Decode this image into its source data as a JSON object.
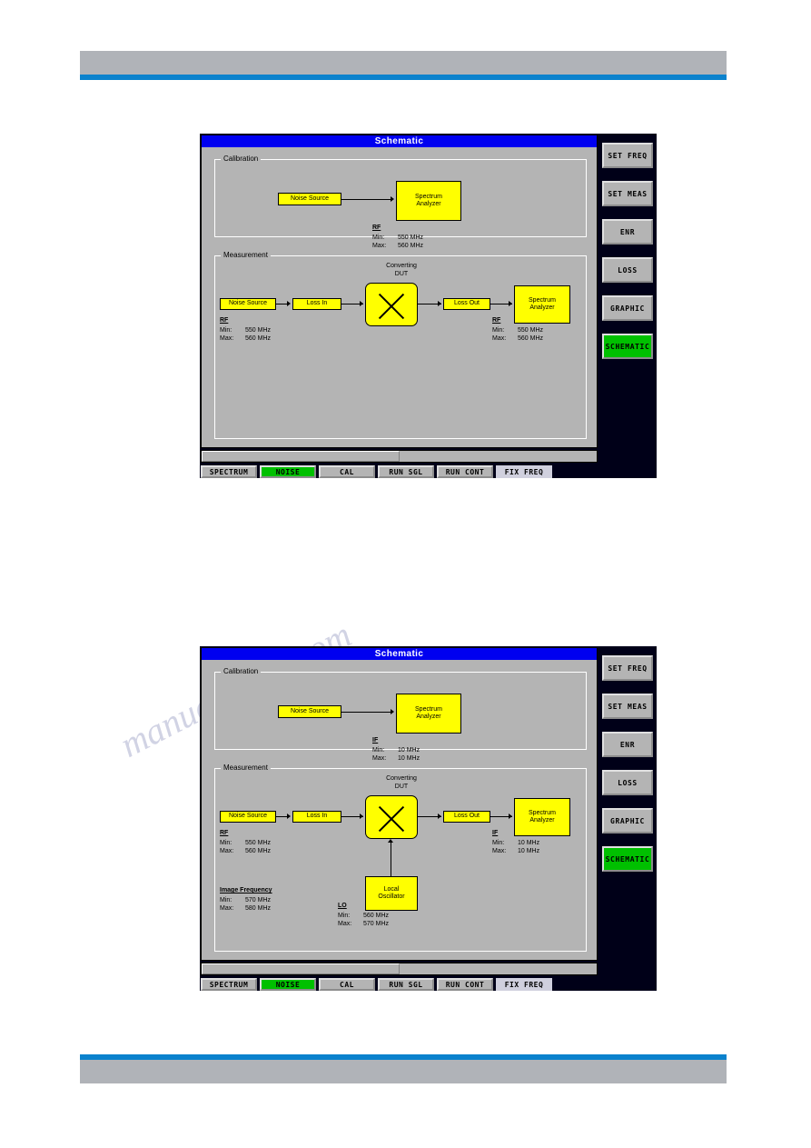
{
  "page": {
    "watermark": "manualshive.com"
  },
  "colors": {
    "titlebar_blue": "#0000f0",
    "panel_grey": "#b4b4b4",
    "block_yellow": "#ffff00",
    "active_green": "#00c000",
    "screen_black": "#000018",
    "rule_blue": "#0b82cd"
  },
  "softkeys": [
    {
      "label": "SET FREQ",
      "active": false
    },
    {
      "label": "SET MEAS",
      "active": false
    },
    {
      "label": "ENR",
      "active": false
    },
    {
      "label": "LOSS",
      "active": false
    },
    {
      "label": "GRAPHIC",
      "active": false
    },
    {
      "label": "SCHEMATIC",
      "active": true
    }
  ],
  "hardkeys": [
    {
      "label": "SPECTRUM",
      "active": false
    },
    {
      "label": "NOISE",
      "active": true
    },
    {
      "label": "CAL",
      "active": false
    },
    {
      "label": "RUN SGL",
      "active": false
    },
    {
      "label": "RUN CONT",
      "active": false
    },
    {
      "label": "FIX FREQ",
      "active": false
    }
  ],
  "screen1": {
    "title": "Schematic",
    "calibration": {
      "group_label": "Calibration",
      "noise_source": "Noise Source",
      "spectrum_analyzer": "Spectrum\nAnalyzer",
      "freq": {
        "header": "RF",
        "min_label": "Min:",
        "min_value": "550 MHz",
        "max_label": "Max:",
        "max_value": "560 MHz"
      }
    },
    "measurement": {
      "group_label": "Measurement",
      "dut_caption": "Converting\nDUT",
      "noise_source": "Noise Source",
      "loss_in": "Loss In",
      "loss_out": "Loss Out",
      "spectrum_analyzer": "Spectrum\nAnalyzer",
      "input_freq": {
        "header": "RF",
        "min_label": "Min:",
        "min_value": "550 MHz",
        "max_label": "Max:",
        "max_value": "560 MHz"
      },
      "output_freq": {
        "header": "RF",
        "min_label": "Min:",
        "min_value": "550 MHz",
        "max_label": "Max:",
        "max_value": "560 MHz"
      }
    }
  },
  "screen2": {
    "title": "Schematic",
    "calibration": {
      "group_label": "Calibration",
      "noise_source": "Noise Source",
      "spectrum_analyzer": "Spectrum\nAnalyzer",
      "freq": {
        "header": "IF",
        "min_label": "Min:",
        "min_value": "10 MHz",
        "max_label": "Max:",
        "max_value": "10 MHz"
      }
    },
    "measurement": {
      "group_label": "Measurement",
      "dut_caption": "Converting\nDUT",
      "noise_source": "Noise Source",
      "loss_in": "Loss In",
      "loss_out": "Loss Out",
      "spectrum_analyzer": "Spectrum\nAnalyzer",
      "local_oscillator": "Local\nOscillator",
      "input_freq": {
        "header": "RF",
        "min_label": "Min:",
        "min_value": "550 MHz",
        "max_label": "Max:",
        "max_value": "560 MHz"
      },
      "output_freq": {
        "header": "IF",
        "min_label": "Min:",
        "min_value": "10 MHz",
        "max_label": "Max:",
        "max_value": "10 MHz"
      },
      "image_freq": {
        "header": "Image Frequency",
        "min_label": "Min:",
        "min_value": "570 MHz",
        "max_label": "Max:",
        "max_value": "580 MHz"
      },
      "lo_freq": {
        "header": "LO",
        "min_label": "Min:",
        "min_value": "560 MHz",
        "max_label": "Max:",
        "max_value": "570 MHz"
      }
    }
  }
}
